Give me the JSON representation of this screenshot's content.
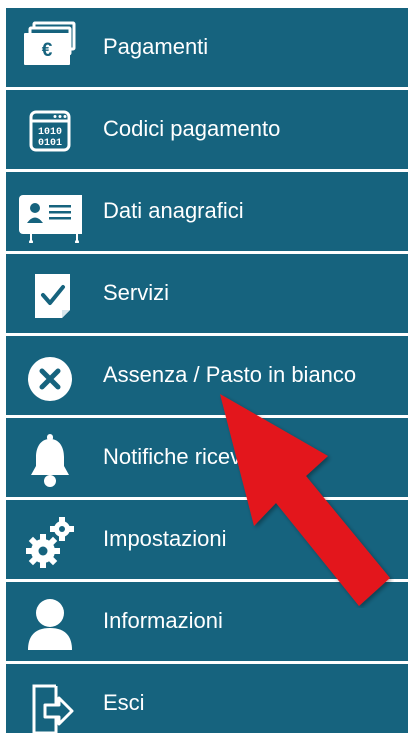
{
  "menu": {
    "items": [
      {
        "label": "Pagamenti",
        "icon": "payments-icon"
      },
      {
        "label": "Codici pagamento",
        "icon": "binary-code-icon"
      },
      {
        "label": "Dati anagrafici",
        "icon": "id-card-icon"
      },
      {
        "label": "Servizi",
        "icon": "checked-document-icon"
      },
      {
        "label": "Assenza / Pasto in bianco",
        "icon": "cancel-circle-icon"
      },
      {
        "label": "Notifiche ricevute",
        "icon": "bell-icon"
      },
      {
        "label": "Impostazioni",
        "icon": "settings-gears-icon"
      },
      {
        "label": "Informazioni",
        "icon": "user-icon"
      },
      {
        "label": "Esci",
        "icon": "logout-icon"
      }
    ]
  },
  "colors": {
    "menu_background": "#16637e",
    "separator": "#ffffff",
    "text": "#ffffff",
    "annotation_arrow": "#e3151b"
  },
  "annotation": {
    "type": "red-arrow",
    "points_to": "Assenza / Pasto in bianco"
  }
}
